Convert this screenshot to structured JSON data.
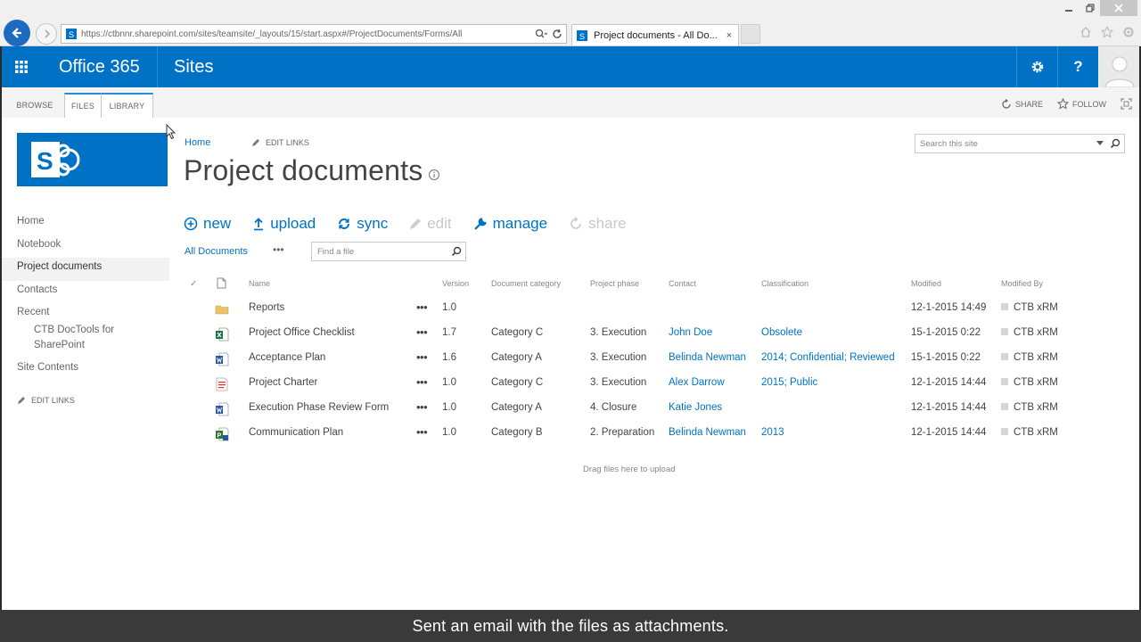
{
  "browser": {
    "url": "https://ctbnnr.sharepoint.com/sites/teamsite/_layouts/15/start.aspx#/ProjectDocuments/Forms/All",
    "tab_title": "Project documents - All Do...",
    "tab_close": "×"
  },
  "suite": {
    "brand": "Office 365",
    "app": "Sites",
    "settings_label": "⚙",
    "help_label": "?"
  },
  "ribbon": {
    "tabs": [
      "BROWSE",
      "FILES",
      "LIBRARY"
    ],
    "selected_tab": "FILES",
    "share": "SHARE",
    "follow": "FOLLOW"
  },
  "leftnav": {
    "items": [
      "Home",
      "Notebook",
      "Project documents",
      "Contacts",
      "Recent"
    ],
    "recent_sub": "CTB DocTools for SharePoint",
    "site_contents": "Site Contents",
    "edit_links": "EDIT LINKS"
  },
  "breadcrumb": {
    "home": "Home",
    "edit_links": "EDIT LINKS"
  },
  "page": {
    "title": "Project documents",
    "search_placeholder": "Search this site"
  },
  "commands": {
    "new": "new",
    "upload": "upload",
    "sync": "sync",
    "edit": "edit",
    "manage": "manage",
    "share": "share"
  },
  "view": {
    "current": "All Documents",
    "more": "•••",
    "find_placeholder": "Find a file"
  },
  "table": {
    "headers": {
      "check": "✓",
      "name": "Name",
      "version": "Version",
      "category": "Document category",
      "phase": "Project phase",
      "contact": "Contact",
      "classification": "Classification",
      "modified": "Modified",
      "modified_by": "Modified By"
    },
    "rows": [
      {
        "icon": "folder-icon",
        "name": "Reports",
        "version": "1.0",
        "category": "",
        "phase": "",
        "contact": "",
        "classification": "",
        "modified": "12-1-2015 14:49",
        "modified_by": "CTB xRM"
      },
      {
        "icon": "excel-file-icon",
        "name": "Project Office Checklist",
        "version": "1.7",
        "category": "Category C",
        "phase": "3. Execution",
        "contact": "John Doe",
        "classification": "Obsolete",
        "modified": "15-1-2015 0:22",
        "modified_by": "CTB xRM"
      },
      {
        "icon": "word-file-icon",
        "name": "Acceptance Plan",
        "version": "1.6",
        "category": "Category A",
        "phase": "3. Execution",
        "contact": "Belinda Newman",
        "classification": "2014; Confidential; Reviewed",
        "modified": "15-1-2015 0:22",
        "modified_by": "CTB xRM"
      },
      {
        "icon": "pdf-file-icon",
        "name": "Project Charter",
        "version": "1.0",
        "category": "Category C",
        "phase": "3. Execution",
        "contact": "Alex Darrow",
        "classification": "2015; Public",
        "modified": "12-1-2015 14:44",
        "modified_by": "CTB xRM"
      },
      {
        "icon": "word-file-icon",
        "name": "Execution Phase Review Form",
        "version": "1.0",
        "category": "Category A",
        "phase": "4. Closure",
        "contact": "Katie Jones",
        "classification": "",
        "modified": "12-1-2015 14:44",
        "modified_by": "CTB xRM"
      },
      {
        "icon": "project-file-icon",
        "name": "Communication Plan",
        "version": "1.0",
        "category": "Category B",
        "phase": "2. Preparation",
        "contact": "Belinda Newman",
        "classification": "2013",
        "modified": "12-1-2015 14:44",
        "modified_by": "CTB xRM"
      }
    ],
    "drag_text": "Drag files here to upload"
  },
  "caption": "Sent an email with the files as attachments.",
  "colors": {
    "suite_blue": "#0072c6",
    "link_blue": "#0072c6",
    "caption_bg": "#3a3a3a"
  }
}
